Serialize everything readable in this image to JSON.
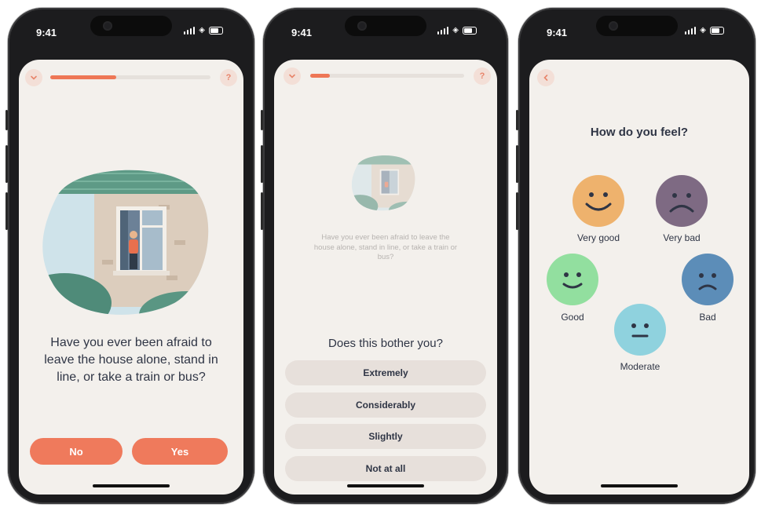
{
  "status_bar": {
    "time": "9:41"
  },
  "screen1": {
    "progress": 0.41,
    "question": "Have you ever been afraid to leave the house alone, stand in line, or take a train or bus?",
    "buttons": {
      "no": "No",
      "yes": "Yes"
    },
    "icons": {
      "collapse": "chevron-down-icon",
      "help": "question-icon"
    },
    "colors": {
      "accent": "#ee7756",
      "background": "#f3f0ec",
      "text": "#2f3545"
    }
  },
  "screen2": {
    "progress": 0.13,
    "faded_question": "Have you ever been afraid to leave the house alone, stand in line, or take a train or bus?",
    "question": "Does this bother you?",
    "options": [
      "Extremely",
      "Considerably",
      "Slightly",
      "Not at all"
    ],
    "icons": {
      "collapse": "chevron-down-icon",
      "help": "question-icon"
    }
  },
  "screen3": {
    "title": "How do you feel?",
    "icons": {
      "back": "chevron-left-icon"
    },
    "moods": [
      {
        "label": "Very good",
        "face": "big-smile",
        "color": "#eeb26d"
      },
      {
        "label": "Very bad",
        "face": "frown",
        "color": "#7e6a83"
      },
      {
        "label": "Good",
        "face": "smile",
        "color": "#92df9f"
      },
      {
        "label": "Bad",
        "face": "sad",
        "color": "#5c8db8"
      },
      {
        "label": "Moderate",
        "face": "neutral",
        "color": "#8fd2de"
      }
    ]
  }
}
